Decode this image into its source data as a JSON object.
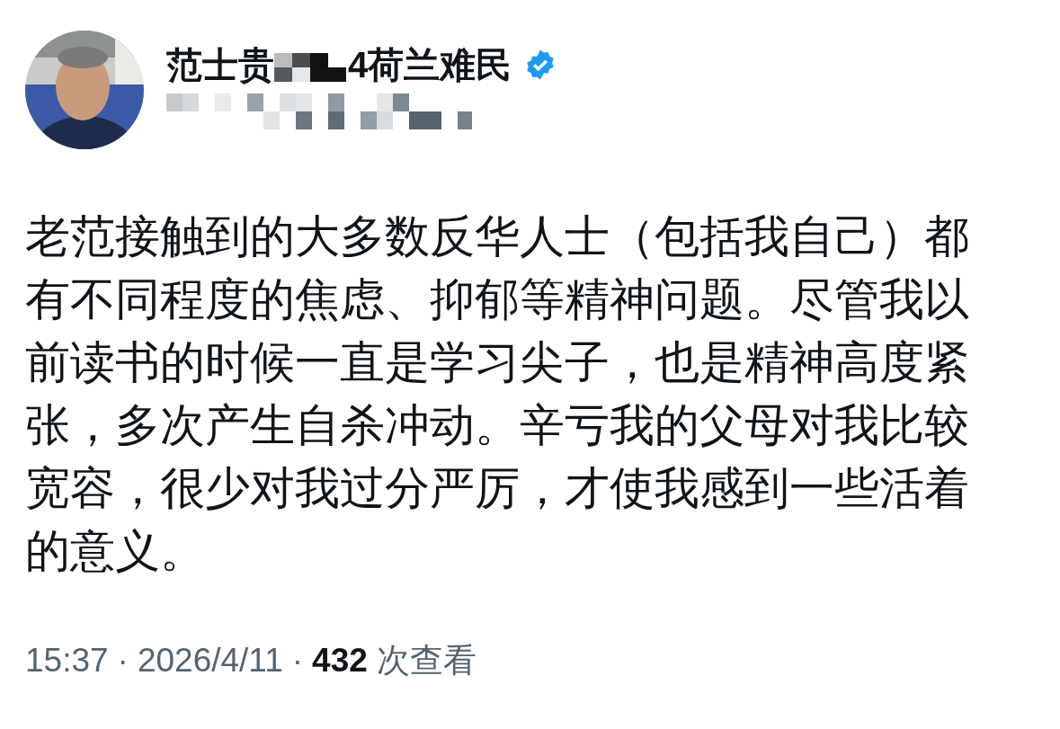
{
  "author": {
    "name_parts": [
      "范士贵",
      "4荷兰难民"
    ],
    "name_redacted": true,
    "verified": true,
    "handle_redacted": true
  },
  "post": {
    "text": "老范接触到的大多数反华人士（包括我自己）都有不同程度的焦虑、抑郁等精神问题。尽管我以前读书的时候一直是学习尖子，也是精神高度紧张，多次产生自杀冲动。辛亏我的父母对我比较宽容，很少对我过分严厉，才使我感到一些活着的意义。"
  },
  "meta": {
    "time": "15:37",
    "separator": "·",
    "date": "2026/4/11",
    "views": "432",
    "views_label": "次查看"
  }
}
